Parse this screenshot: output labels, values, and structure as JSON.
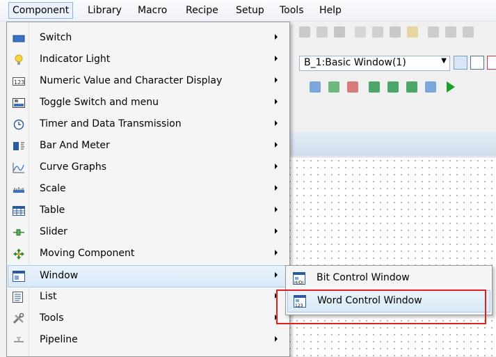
{
  "menubar": {
    "items": [
      {
        "label": "Component",
        "active": true
      },
      {
        "label": "Library"
      },
      {
        "label": "Macro"
      },
      {
        "label": "Recipe"
      },
      {
        "label": "Setup"
      },
      {
        "label": "Tools"
      },
      {
        "label": "Help"
      }
    ]
  },
  "window_selector": {
    "value": "B_1:Basic Window(1)"
  },
  "component_menu": {
    "items": [
      {
        "label": "Switch",
        "icon": "switch-icon",
        "has_submenu": true
      },
      {
        "label": "Indicator Light",
        "icon": "bulb-icon",
        "has_submenu": true
      },
      {
        "label": "Numeric Value and Character Display",
        "icon": "numeric-display-icon",
        "has_submenu": true
      },
      {
        "label": "Toggle Switch and menu",
        "icon": "toggle-switch-icon",
        "has_submenu": true
      },
      {
        "label": "Timer and Data Transmission",
        "icon": "clock-icon",
        "has_submenu": true
      },
      {
        "label": "Bar And Meter",
        "icon": "bar-meter-icon",
        "has_submenu": true
      },
      {
        "label": "Curve Graphs",
        "icon": "curve-graph-icon",
        "has_submenu": true
      },
      {
        "label": "Scale",
        "icon": "scale-icon",
        "has_submenu": true
      },
      {
        "label": "Table",
        "icon": "table-icon",
        "has_submenu": true
      },
      {
        "label": "Slider",
        "icon": "slider-icon",
        "has_submenu": true
      },
      {
        "label": "Moving Component",
        "icon": "move-icon",
        "has_submenu": true
      },
      {
        "label": "Window",
        "icon": "window-icon",
        "has_submenu": true,
        "highlighted": true
      },
      {
        "label": "List",
        "icon": "list-icon",
        "has_submenu": true
      },
      {
        "label": "Tools",
        "icon": "tools-icon",
        "has_submenu": true
      },
      {
        "label": "Pipeline",
        "icon": "pipeline-icon",
        "has_submenu": true
      }
    ]
  },
  "window_submenu": {
    "items": [
      {
        "label": "Bit Control Window",
        "icon": "bit-window-icon"
      },
      {
        "label": "Word Control Window",
        "icon": "word-window-icon",
        "highlighted": true
      }
    ]
  },
  "colors": {
    "accent": "#3a73c4",
    "highlight_border": "#e02020"
  }
}
